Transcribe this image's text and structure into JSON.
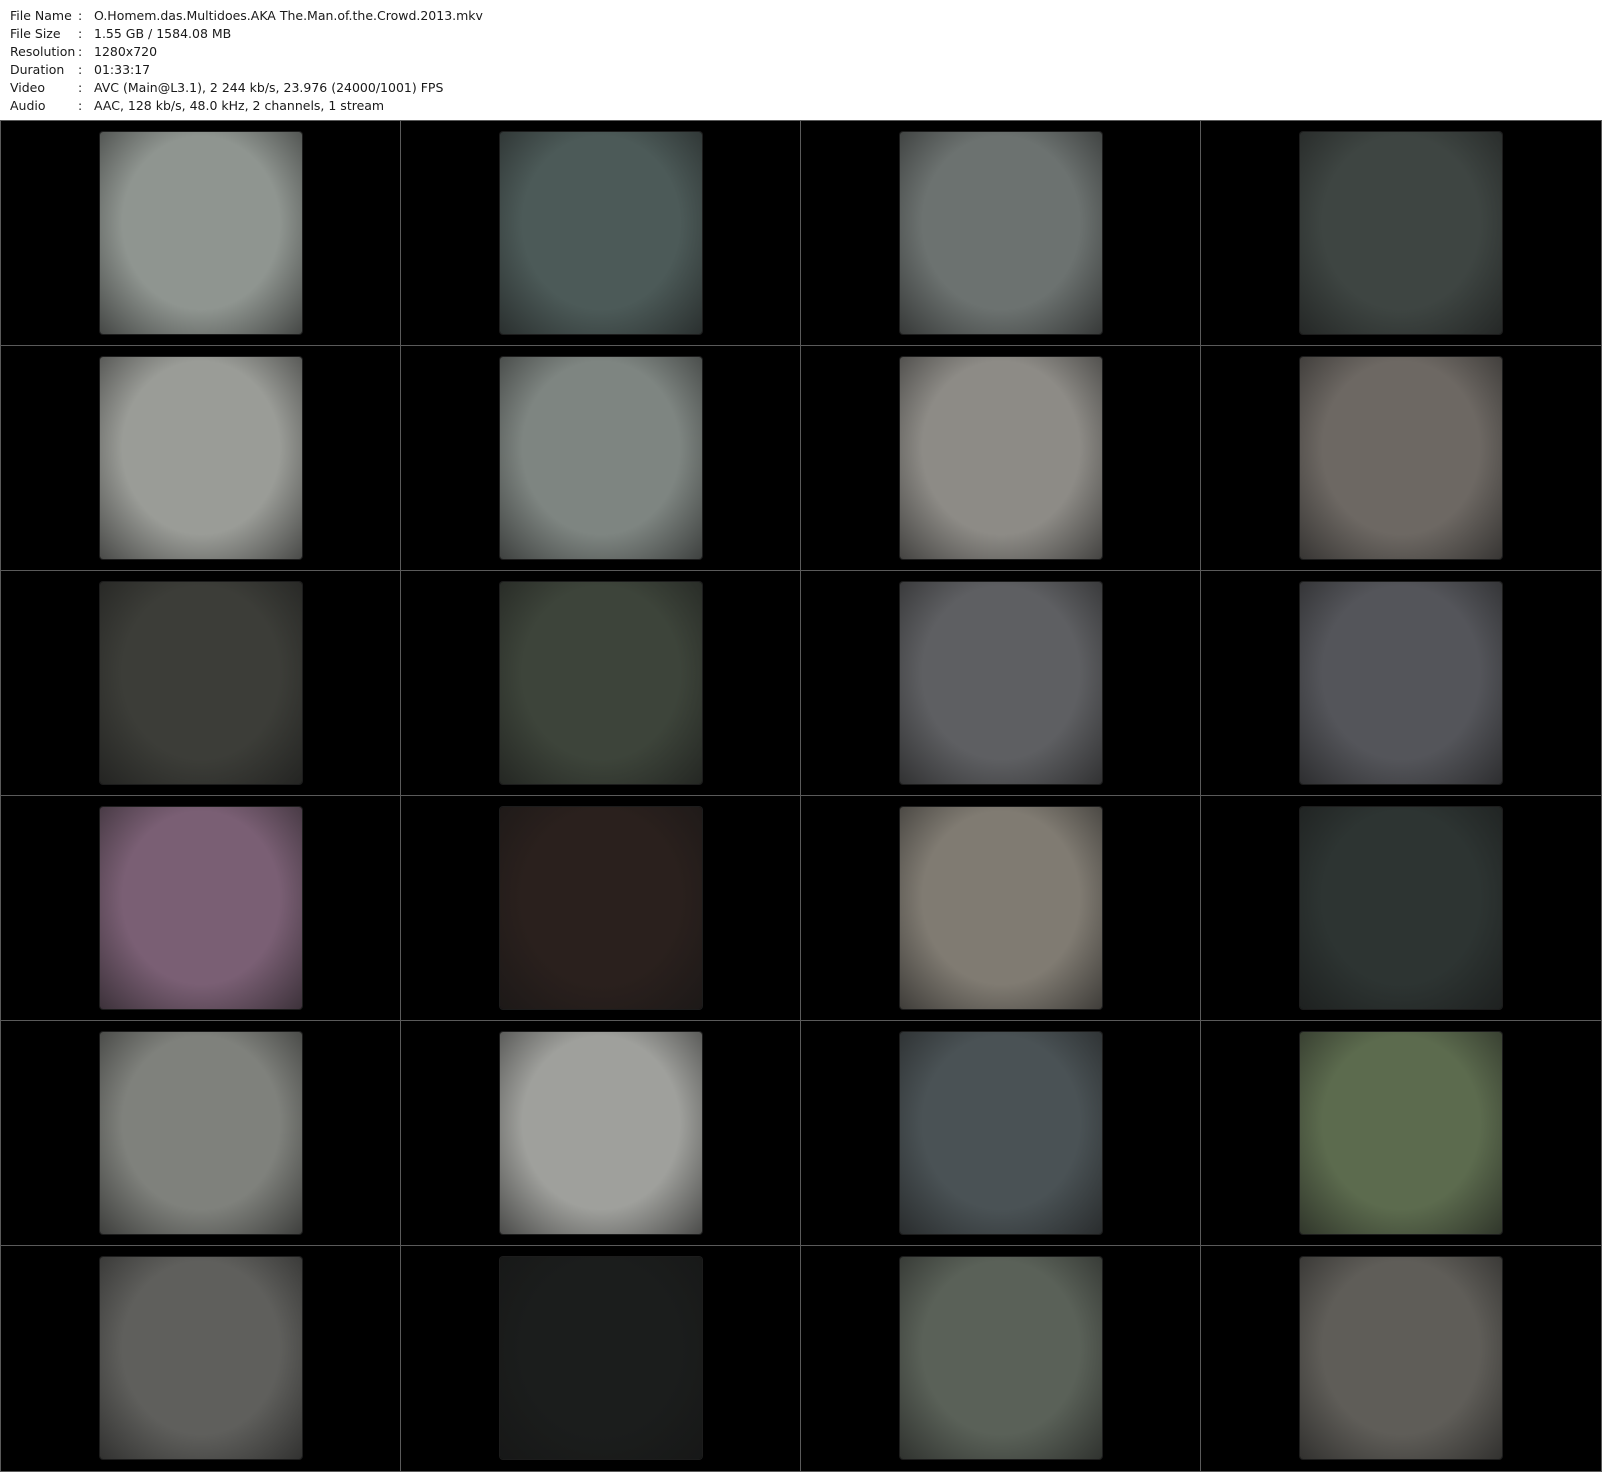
{
  "info": {
    "rows": [
      {
        "label": "File Name",
        "value": "O.Homem.das.Multidoes.AKA The.Man.of.the.Crowd.2013.mkv"
      },
      {
        "label": "File Size",
        "value": "1.55 GB  / 1584.08 MB"
      },
      {
        "label": "Resolution",
        "value": "1280x720"
      },
      {
        "label": "Duration",
        "value": "01:33:17"
      },
      {
        "label": "Video",
        "value": "AVC (Main@L3.1), 2 244 kb/s, 23.976 (24000/1001) FPS"
      },
      {
        "label": "Audio",
        "value": "AAC, 128 kb/s, 48.0 kHz, 2 channels, 1 stream"
      }
    ]
  },
  "thumbnails": [
    {
      "tone": "#8f9590"
    },
    {
      "tone": "#4c5a58"
    },
    {
      "tone": "#6c7270"
    },
    {
      "tone": "#3e4542"
    },
    {
      "tone": "#9a9c97"
    },
    {
      "tone": "#7e8581"
    },
    {
      "tone": "#8d8b86"
    },
    {
      "tone": "#6d6863"
    },
    {
      "tone": "#3c3d38"
    },
    {
      "tone": "#3d443a"
    },
    {
      "tone": "#5e5f62"
    },
    {
      "tone": "#54555a"
    },
    {
      "tone": "#7a5f74"
    },
    {
      "tone": "#2a201d"
    },
    {
      "tone": "#807b72"
    },
    {
      "tone": "#2d3432"
    },
    {
      "tone": "#7f817c"
    },
    {
      "tone": "#9fa09c"
    },
    {
      "tone": "#4a5255"
    },
    {
      "tone": "#5c6b4e"
    },
    {
      "tone": "#5f5f5c"
    },
    {
      "tone": "#1b1d1c"
    },
    {
      "tone": "#5a6158"
    },
    {
      "tone": "#5f5d58"
    }
  ]
}
